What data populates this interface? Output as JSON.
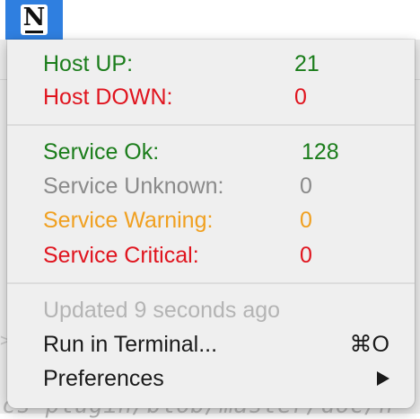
{
  "colors": {
    "green": "#1b7d1b",
    "red": "#e0141e",
    "gray": "#8a8a8a",
    "orange": "#f0a020",
    "text": "#1a1a1a",
    "disabled": "#b4b4b4",
    "accent": "#2f7fe0"
  },
  "status_item": {
    "icon": "nagios-logo-icon",
    "glyph": "N"
  },
  "hosts": [
    {
      "label": "Host UP:",
      "value": "21",
      "color": "green"
    },
    {
      "label": "Host DOWN:",
      "value": "0",
      "color": "red"
    }
  ],
  "services": [
    {
      "label": "Service Ok:",
      "value": "128",
      "color": "green"
    },
    {
      "label": "Service Unknown:",
      "value": "0",
      "color": "gray"
    },
    {
      "label": "Service Warning:",
      "value": "0",
      "color": "orange"
    },
    {
      "label": "Service Critical:",
      "value": "0",
      "color": "red"
    }
  ],
  "footer": {
    "updated": "Updated 9 seconds ago",
    "run_terminal": "Run in Terminal...",
    "run_terminal_shortcut": "⌘O",
    "preferences": "Preferences"
  },
  "background": {
    "code_text": "ics-plugin/blob/master/doc/n",
    "angle_glyph": ">"
  }
}
